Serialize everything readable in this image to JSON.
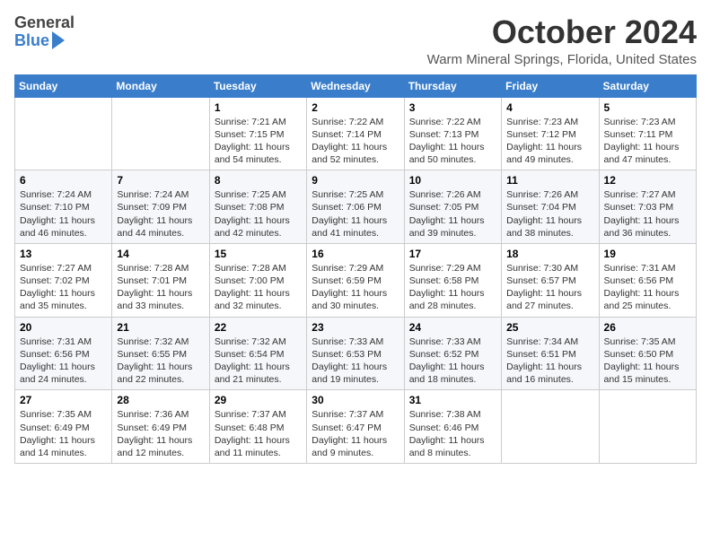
{
  "logo": {
    "general": "General",
    "blue": "Blue"
  },
  "title": "October 2024",
  "location": "Warm Mineral Springs, Florida, United States",
  "days_of_week": [
    "Sunday",
    "Monday",
    "Tuesday",
    "Wednesday",
    "Thursday",
    "Friday",
    "Saturday"
  ],
  "weeks": [
    [
      {
        "day": "",
        "info": ""
      },
      {
        "day": "",
        "info": ""
      },
      {
        "day": "1",
        "info": "Sunrise: 7:21 AM\nSunset: 7:15 PM\nDaylight: 11 hours and 54 minutes."
      },
      {
        "day": "2",
        "info": "Sunrise: 7:22 AM\nSunset: 7:14 PM\nDaylight: 11 hours and 52 minutes."
      },
      {
        "day": "3",
        "info": "Sunrise: 7:22 AM\nSunset: 7:13 PM\nDaylight: 11 hours and 50 minutes."
      },
      {
        "day": "4",
        "info": "Sunrise: 7:23 AM\nSunset: 7:12 PM\nDaylight: 11 hours and 49 minutes."
      },
      {
        "day": "5",
        "info": "Sunrise: 7:23 AM\nSunset: 7:11 PM\nDaylight: 11 hours and 47 minutes."
      }
    ],
    [
      {
        "day": "6",
        "info": "Sunrise: 7:24 AM\nSunset: 7:10 PM\nDaylight: 11 hours and 46 minutes."
      },
      {
        "day": "7",
        "info": "Sunrise: 7:24 AM\nSunset: 7:09 PM\nDaylight: 11 hours and 44 minutes."
      },
      {
        "day": "8",
        "info": "Sunrise: 7:25 AM\nSunset: 7:08 PM\nDaylight: 11 hours and 42 minutes."
      },
      {
        "day": "9",
        "info": "Sunrise: 7:25 AM\nSunset: 7:06 PM\nDaylight: 11 hours and 41 minutes."
      },
      {
        "day": "10",
        "info": "Sunrise: 7:26 AM\nSunset: 7:05 PM\nDaylight: 11 hours and 39 minutes."
      },
      {
        "day": "11",
        "info": "Sunrise: 7:26 AM\nSunset: 7:04 PM\nDaylight: 11 hours and 38 minutes."
      },
      {
        "day": "12",
        "info": "Sunrise: 7:27 AM\nSunset: 7:03 PM\nDaylight: 11 hours and 36 minutes."
      }
    ],
    [
      {
        "day": "13",
        "info": "Sunrise: 7:27 AM\nSunset: 7:02 PM\nDaylight: 11 hours and 35 minutes."
      },
      {
        "day": "14",
        "info": "Sunrise: 7:28 AM\nSunset: 7:01 PM\nDaylight: 11 hours and 33 minutes."
      },
      {
        "day": "15",
        "info": "Sunrise: 7:28 AM\nSunset: 7:00 PM\nDaylight: 11 hours and 32 minutes."
      },
      {
        "day": "16",
        "info": "Sunrise: 7:29 AM\nSunset: 6:59 PM\nDaylight: 11 hours and 30 minutes."
      },
      {
        "day": "17",
        "info": "Sunrise: 7:29 AM\nSunset: 6:58 PM\nDaylight: 11 hours and 28 minutes."
      },
      {
        "day": "18",
        "info": "Sunrise: 7:30 AM\nSunset: 6:57 PM\nDaylight: 11 hours and 27 minutes."
      },
      {
        "day": "19",
        "info": "Sunrise: 7:31 AM\nSunset: 6:56 PM\nDaylight: 11 hours and 25 minutes."
      }
    ],
    [
      {
        "day": "20",
        "info": "Sunrise: 7:31 AM\nSunset: 6:56 PM\nDaylight: 11 hours and 24 minutes."
      },
      {
        "day": "21",
        "info": "Sunrise: 7:32 AM\nSunset: 6:55 PM\nDaylight: 11 hours and 22 minutes."
      },
      {
        "day": "22",
        "info": "Sunrise: 7:32 AM\nSunset: 6:54 PM\nDaylight: 11 hours and 21 minutes."
      },
      {
        "day": "23",
        "info": "Sunrise: 7:33 AM\nSunset: 6:53 PM\nDaylight: 11 hours and 19 minutes."
      },
      {
        "day": "24",
        "info": "Sunrise: 7:33 AM\nSunset: 6:52 PM\nDaylight: 11 hours and 18 minutes."
      },
      {
        "day": "25",
        "info": "Sunrise: 7:34 AM\nSunset: 6:51 PM\nDaylight: 11 hours and 16 minutes."
      },
      {
        "day": "26",
        "info": "Sunrise: 7:35 AM\nSunset: 6:50 PM\nDaylight: 11 hours and 15 minutes."
      }
    ],
    [
      {
        "day": "27",
        "info": "Sunrise: 7:35 AM\nSunset: 6:49 PM\nDaylight: 11 hours and 14 minutes."
      },
      {
        "day": "28",
        "info": "Sunrise: 7:36 AM\nSunset: 6:49 PM\nDaylight: 11 hours and 12 minutes."
      },
      {
        "day": "29",
        "info": "Sunrise: 7:37 AM\nSunset: 6:48 PM\nDaylight: 11 hours and 11 minutes."
      },
      {
        "day": "30",
        "info": "Sunrise: 7:37 AM\nSunset: 6:47 PM\nDaylight: 11 hours and 9 minutes."
      },
      {
        "day": "31",
        "info": "Sunrise: 7:38 AM\nSunset: 6:46 PM\nDaylight: 11 hours and 8 minutes."
      },
      {
        "day": "",
        "info": ""
      },
      {
        "day": "",
        "info": ""
      }
    ]
  ]
}
